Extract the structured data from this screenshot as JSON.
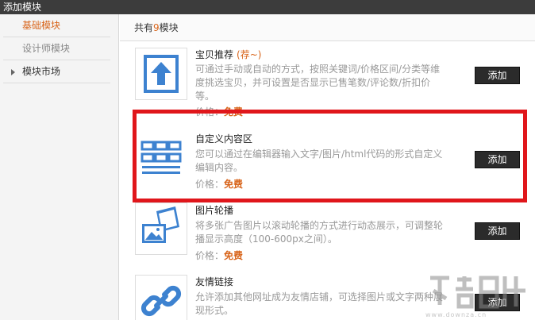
{
  "window": {
    "title": "添加模块"
  },
  "sidebar": {
    "items": [
      {
        "label": "基础模块",
        "state": "active"
      },
      {
        "label": "设计师模块",
        "state": "muted"
      },
      {
        "label": "模块市场",
        "state": "collapsed"
      }
    ]
  },
  "summary": {
    "prefix": "共有",
    "count": "9",
    "suffix": "模块"
  },
  "modules": [
    {
      "title": "宝贝推荐",
      "tag": "(荐~)",
      "description": "可通过手动或自动的方式，按照关键词/价格区间/分类等维度挑选宝贝，并可设置是否显示已售笔数/评论数/折扣价等。",
      "price_label": "价格：",
      "price": "免费",
      "button": "添加",
      "icon": "upload-arrow-icon"
    },
    {
      "title": "自定义内容区",
      "tag": "",
      "description": "您可以通过在编辑器输入文字/图片/html代码的形式自定义编辑内容。",
      "price_label": "价格：",
      "price": "免费",
      "button": "添加",
      "icon": "grid-layout-icon"
    },
    {
      "title": "图片轮播",
      "tag": "",
      "description": "将多张广告图片以滚动轮播的方式进行动态展示，可调整轮播显示高度（100-600px之间）。",
      "price_label": "价格：",
      "price": "免费",
      "button": "添加",
      "icon": "image-carousel-icon"
    },
    {
      "title": "友情链接",
      "tag": "",
      "description": "允许添加其他网址成为友情店铺，可选择图片或文字两种展现形式。",
      "price_label": "",
      "price": "",
      "button": "添加",
      "icon": "chain-link-icon"
    }
  ],
  "highlight": {
    "color": "#e0161b"
  },
  "colors": {
    "accent": "#d8641a",
    "icon_blue": "#3d82d0",
    "button_bg": "#2b2b2b"
  },
  "watermark": {
    "url": "www.downza.cn"
  }
}
